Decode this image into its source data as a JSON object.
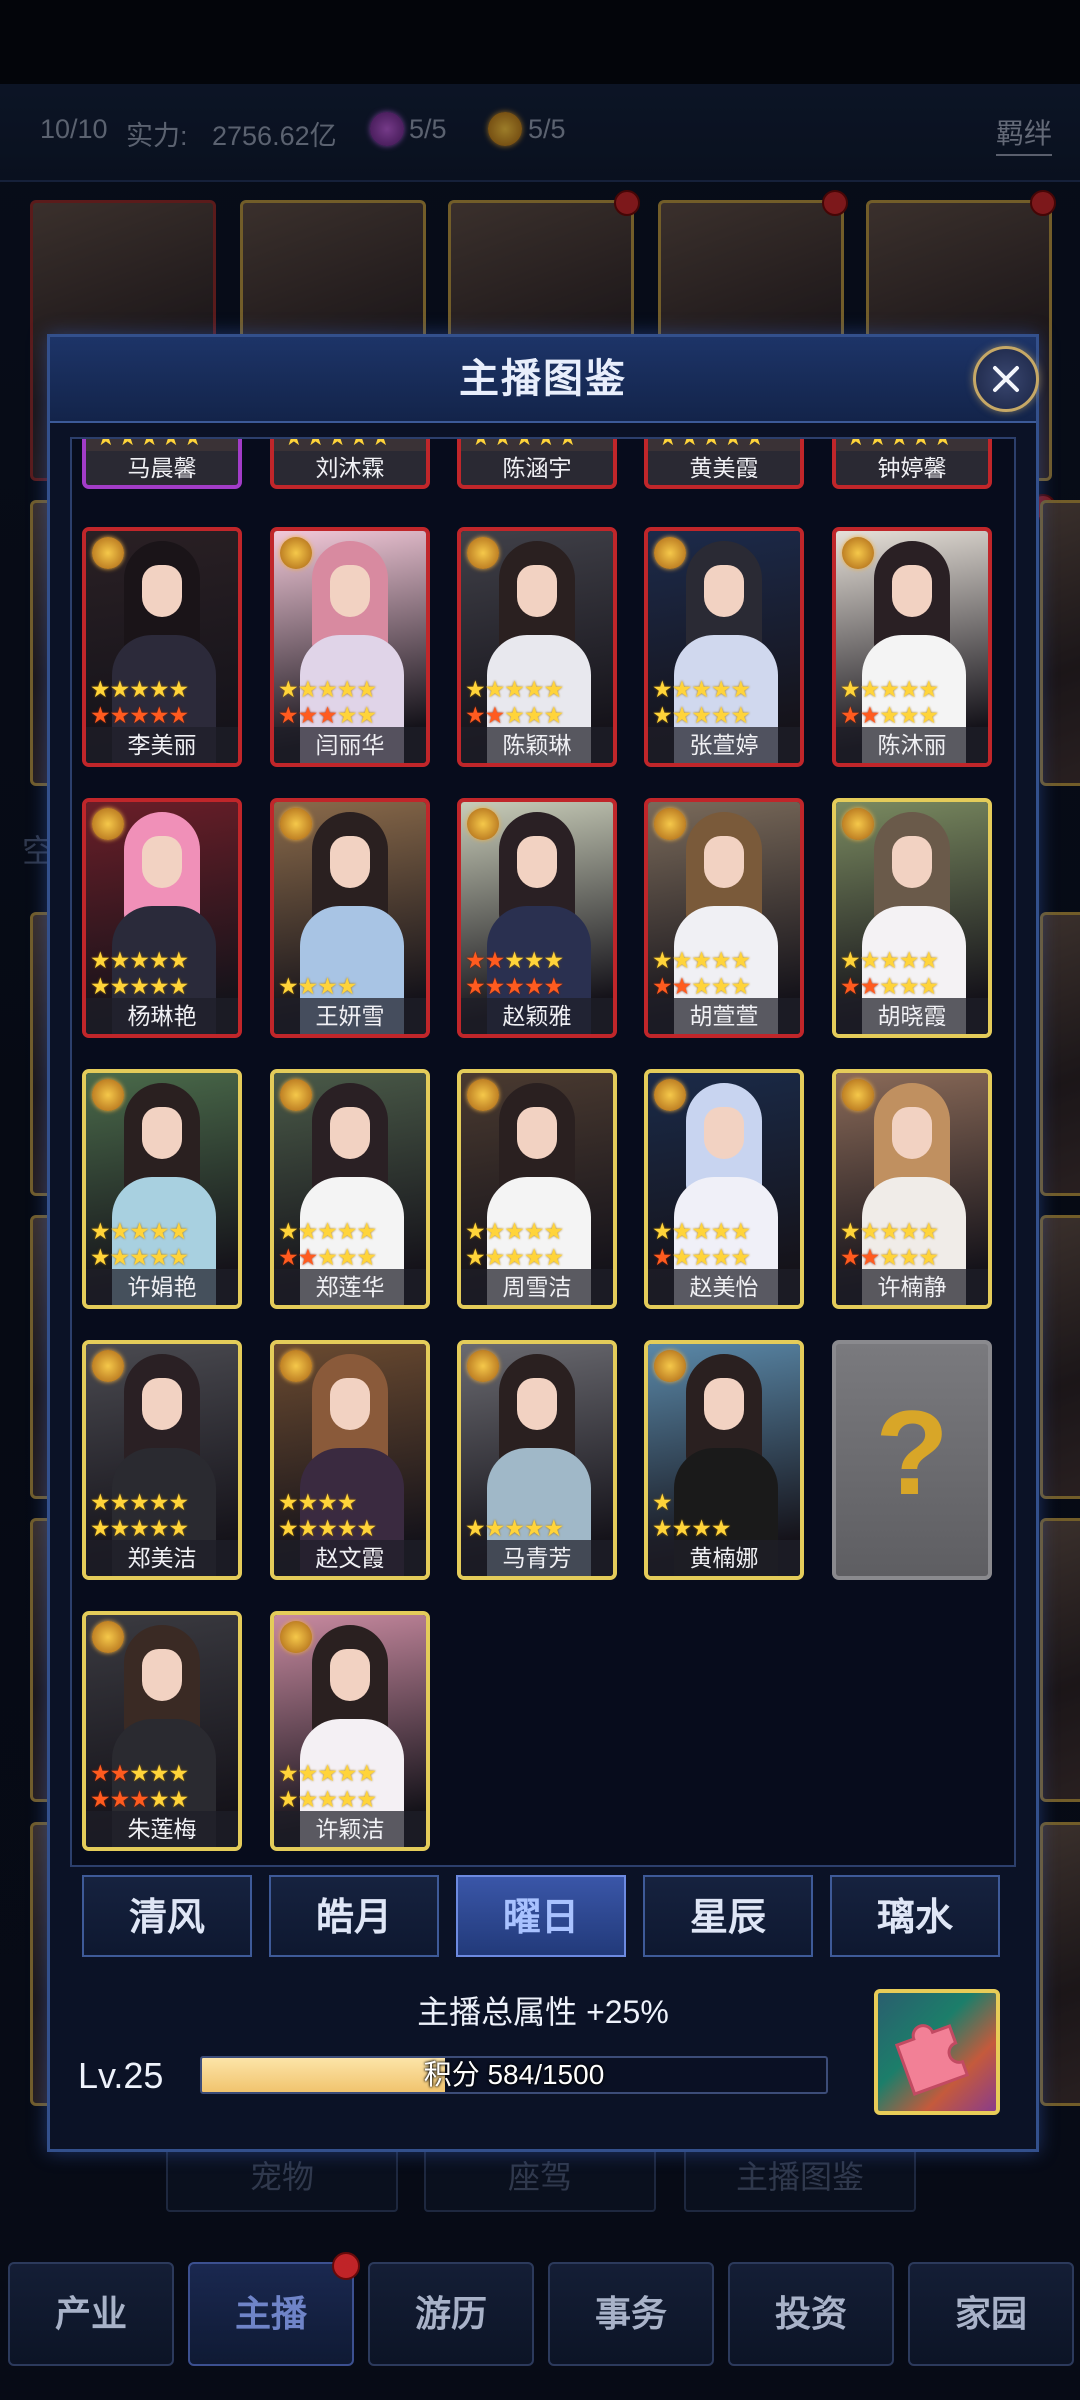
{
  "top_bar": {
    "count": "10/10",
    "power_label": "实力:",
    "power_value": "2756.62亿",
    "rose_count": "5/5",
    "sun_count": "5/5",
    "bond_link": "羁绊"
  },
  "background": {
    "side_label": "空",
    "buttons": [
      "宠物",
      "座驾",
      "主播图鉴"
    ]
  },
  "modal": {
    "title": "主播图鉴",
    "partial_row": [
      "马晨馨",
      "刘沐霖",
      "陈涵宇",
      "黄美霞",
      "钟婷馨"
    ],
    "cards": [
      {
        "name": "李美丽",
        "rarity": "red",
        "stars_top": "yyyyy",
        "stars_bottom": "ooooo"
      },
      {
        "name": "闫丽华",
        "rarity": "red",
        "stars_top": "yyyyy",
        "stars_bottom": "oooyy"
      },
      {
        "name": "陈颖琳",
        "rarity": "red",
        "stars_top": "yyyyy",
        "stars_bottom": "ooyyy"
      },
      {
        "name": "张萱婷",
        "rarity": "red",
        "stars_top": "yyyyy",
        "stars_bottom": "yyyyy"
      },
      {
        "name": "陈沐丽",
        "rarity": "red",
        "stars_top": "yyyyy",
        "stars_bottom": "ooyyy"
      },
      {
        "name": "杨琳艳",
        "rarity": "red",
        "stars_top": "yyyyy",
        "stars_bottom": "yyyyy"
      },
      {
        "name": "王妍雪",
        "rarity": "red",
        "stars_top": "",
        "stars_bottom": "yyyy"
      },
      {
        "name": "赵颖雅",
        "rarity": "red",
        "stars_top": "ooyyy",
        "stars_bottom": "ooooo"
      },
      {
        "name": "胡萱萱",
        "rarity": "red",
        "stars_top": "yyyyy",
        "stars_bottom": "ooyyy"
      },
      {
        "name": "胡晓霞",
        "rarity": "gold",
        "stars_top": "yyyyy",
        "stars_bottom": "ooyyy"
      },
      {
        "name": "许娟艳",
        "rarity": "gold",
        "stars_top": "yyyyy",
        "stars_bottom": "yyyyy"
      },
      {
        "name": "郑莲华",
        "rarity": "gold",
        "stars_top": "yyyyy",
        "stars_bottom": "ooyyy"
      },
      {
        "name": "周雪洁",
        "rarity": "gold",
        "stars_top": "yyyyy",
        "stars_bottom": "yyyyy"
      },
      {
        "name": "赵美怡",
        "rarity": "gold",
        "stars_top": "yyyyy",
        "stars_bottom": "oyyyy"
      },
      {
        "name": "许楠静",
        "rarity": "gold",
        "stars_top": "yyyyy",
        "stars_bottom": "ooyyy"
      },
      {
        "name": "郑美洁",
        "rarity": "gold",
        "stars_top": "yyyyy",
        "stars_bottom": "yyyyy"
      },
      {
        "name": "赵文霞",
        "rarity": "gold",
        "stars_top": "yyyy",
        "stars_bottom": "yyyyy"
      },
      {
        "name": "马青芳",
        "rarity": "gold",
        "stars_top": "",
        "stars_bottom": "yyyyy"
      },
      {
        "name": "黄楠娜",
        "rarity": "gold",
        "stars_top": "y",
        "stars_bottom": "yyyy"
      },
      {
        "name": "",
        "rarity": "unknown",
        "stars_top": "",
        "stars_bottom": ""
      },
      {
        "name": "朱莲梅",
        "rarity": "gold",
        "stars_top": "ooyyy",
        "stars_bottom": "oooyy"
      },
      {
        "name": "许颖洁",
        "rarity": "gold",
        "stars_top": "yyyyy",
        "stars_bottom": "yyyyy"
      }
    ],
    "unknown_symbol": "?",
    "tabs": [
      "清风",
      "皓月",
      "曜日",
      "星辰",
      "璃水"
    ],
    "active_tab": 2,
    "bonus": "主播总属性 +25%",
    "level": "Lv.25",
    "points_label": "积分 584/1500",
    "points_current": 584,
    "points_max": 1500
  },
  "nav": {
    "items": [
      "产业",
      "主播",
      "游历",
      "事务",
      "投资",
      "家园"
    ],
    "active": 1
  },
  "colors": {
    "accent_blue": "#33508c",
    "star_yellow": "#ffd43a",
    "star_orange": "#ff5b1f",
    "rarity_red": "#c0262a",
    "rarity_gold": "#e4cc5a",
    "rarity_purple": "#a23cc8"
  }
}
